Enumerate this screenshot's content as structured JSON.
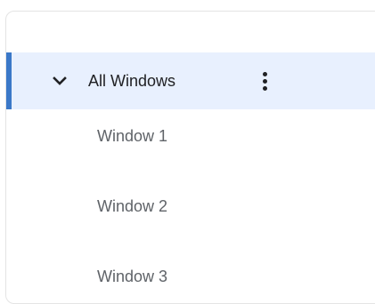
{
  "tree": {
    "group": {
      "label": "All Windows",
      "expand_icon": "chevron-down-icon",
      "menu_icon": "more-vertical-icon",
      "accent_color": "#3b78c8",
      "highlight_color": "#e8f0fe"
    },
    "children": [
      {
        "label": "Window 1"
      },
      {
        "label": "Window 2"
      },
      {
        "label": "Window 3"
      }
    ]
  }
}
